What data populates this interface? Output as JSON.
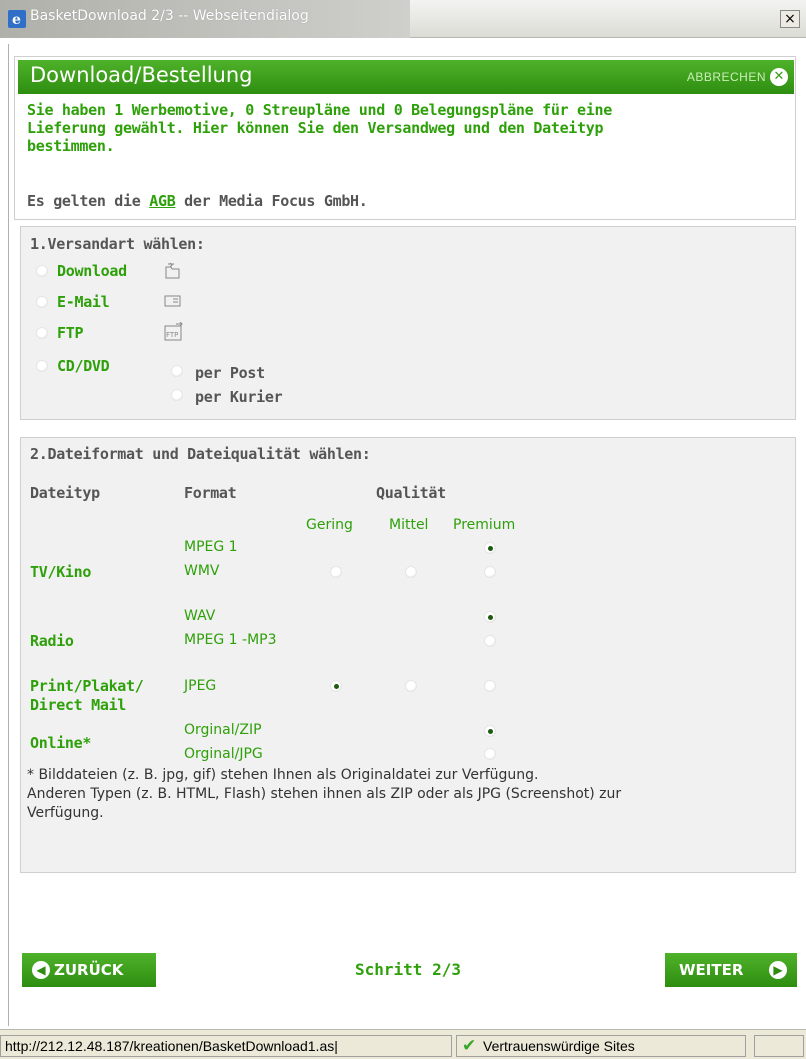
{
  "window": {
    "title": "BasketDownload 2/3 -- Webseitendialog",
    "close_label": "×"
  },
  "header": {
    "title": "Download/Bestellung",
    "cancel_label": "ABBRECHEN",
    "cancel_icon": "close-circle-icon"
  },
  "intro": {
    "line1": "Sie haben 1 Werbemotive, 0 Streupläne und 0 Belegungspläne für eine",
    "line2": "Lieferung gewählt. Hier können Sie den Versandweg und den Dateityp",
    "line3": "bestimmen.",
    "agb_prefix": "Es gelten die ",
    "agb_link": "AGB",
    "agb_suffix": " der Media Focus GmbH."
  },
  "shipping": {
    "heading": "1.Versandart wählen:",
    "options": [
      {
        "label": "Download",
        "icon": "download-folder-icon",
        "checked": false
      },
      {
        "label": "E-Mail",
        "icon": "mail-icon",
        "checked": false
      },
      {
        "label": "FTP",
        "icon": "ftp-icon",
        "checked": false
      },
      {
        "label": "CD/DVD",
        "icon": "",
        "checked": false
      }
    ],
    "cd_options": [
      {
        "label": "per Post",
        "checked": false
      },
      {
        "label": "per Kurier",
        "checked": false
      }
    ]
  },
  "format": {
    "heading": "2.Dateiformat und Dateiqualität wählen:",
    "col_type": "Dateityp",
    "col_format": "Format",
    "col_quality": "Qualität",
    "q_low": "Gering",
    "q_mid": "Mittel",
    "q_premium": "Premium",
    "groups": [
      {
        "type": "TV/Kino",
        "formats": [
          "MPEG 1",
          "WMV"
        ]
      },
      {
        "type": "Radio",
        "formats": [
          "WAV",
          "MPEG 1 -MP3"
        ]
      },
      {
        "type_line1": "Print/Plakat/",
        "type_line2": "Direct Mail",
        "formats": [
          "JPEG"
        ]
      },
      {
        "type": "Online*",
        "formats": [
          "Orginal/ZIP",
          "Orginal/JPG"
        ]
      }
    ],
    "note_line1": "* Bilddateien (z. B. jpg, gif) stehen Ihnen als Originaldatei zur Verfügung.",
    "note_line2": "Anderen Typen (z. B. HTML, Flash) stehen ihnen als ZIP oder als JPG (Screenshot) zur",
    "note_line3": "Verfügung."
  },
  "footer": {
    "back_label": "ZURÜCK",
    "next_label": "WEITER",
    "step_label": "Schritt 2/3"
  },
  "statusbar": {
    "url": "http://212.12.48.187/kreationen/BasketDownload1.as|",
    "zone": "Vertrauenswürdige Sites"
  },
  "colors": {
    "green": "#2ea00a",
    "header_green": "#3a9c17",
    "panel_grey": "#f1f1f1"
  }
}
